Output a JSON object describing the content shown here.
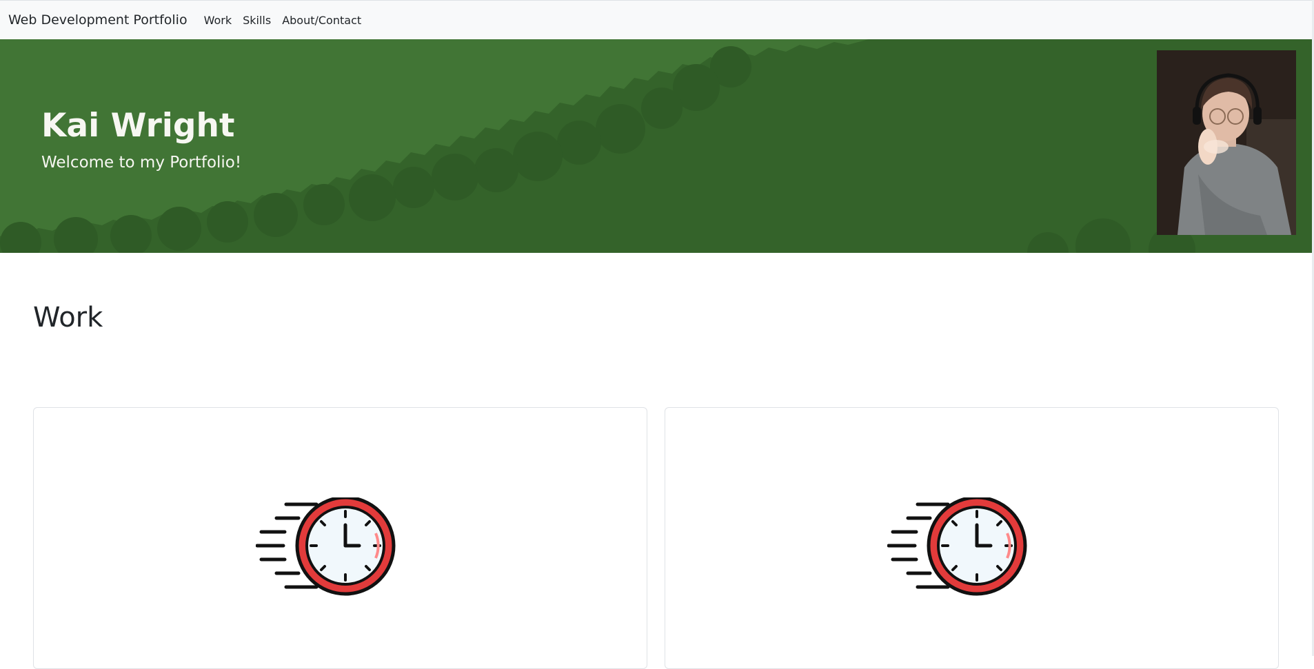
{
  "navbar": {
    "brand": "Web Development Portfolio",
    "links": [
      {
        "label": "Work"
      },
      {
        "label": "Skills"
      },
      {
        "label": "About/Contact"
      }
    ]
  },
  "hero": {
    "title": "Kai Wright",
    "subtitle": "Welcome to my Portfolio!"
  },
  "work": {
    "heading": "Work",
    "cards": [
      {
        "icon": "fast-clock-icon"
      },
      {
        "icon": "fast-clock-icon"
      }
    ]
  },
  "colors": {
    "hero_background": "#34632a",
    "hero_light": "#417535",
    "navbar_background": "#f8f9fa",
    "clock_red": "#e23b3b"
  }
}
